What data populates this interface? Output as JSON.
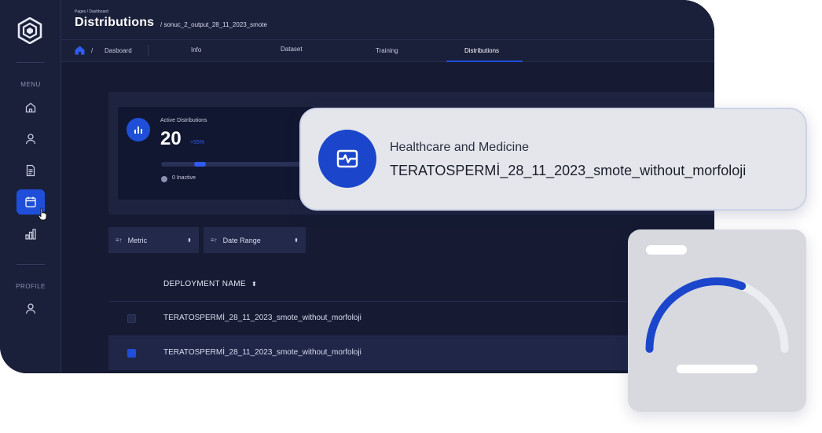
{
  "header": {
    "crumb_small": "Pages / Dashboard",
    "title": "Distributions",
    "path": "/   sonuc_2_output_28_11_2023_smote"
  },
  "sidebar": {
    "menu_label": "MENU",
    "profile_label": "PROFILE",
    "items": [
      {
        "icon": "home-icon"
      },
      {
        "icon": "user-icon"
      },
      {
        "icon": "document-icon"
      },
      {
        "icon": "calendar-icon",
        "active": true
      },
      {
        "icon": "bar-chart-icon"
      }
    ],
    "profile_icon": "user-icon"
  },
  "tabs": {
    "breadcrumb_sep": "/",
    "breadcrumb_label": "Dasboard",
    "items": [
      "Info",
      "Dataset",
      "Training",
      "Distributions"
    ],
    "active": "Distributions"
  },
  "stats": {
    "label": "Active Distributions",
    "value": "20",
    "delta": "+55%",
    "progress_fraction": 0.08,
    "inactive_label": "0 Inactive"
  },
  "filters": {
    "metric_label": "Metric",
    "date_label": "Date Range"
  },
  "table": {
    "header": "DEPLOYMENT NAME",
    "sort_glyph": "⬍",
    "rows": [
      {
        "name": "TERATOSPERMİ_28_11_2023_smote_without_morfoloji",
        "selected": false
      },
      {
        "name": "TERATOSPERMİ_28_11_2023_smote_without_morfoloji",
        "selected": true
      }
    ]
  },
  "overlay": {
    "category": "Healthcare and Medicine",
    "name": "TERATOSPERMİ_28_11_2023_smote_without_morfoloji",
    "icon": "heartbeat-icon"
  },
  "gauge": {
    "fraction": 0.62,
    "accent": "#1b46cc",
    "track": "#ecedf0"
  },
  "colors": {
    "accent": "#1f4fd9",
    "bg": "#161b33",
    "sidebar": "#1a1f3a"
  }
}
